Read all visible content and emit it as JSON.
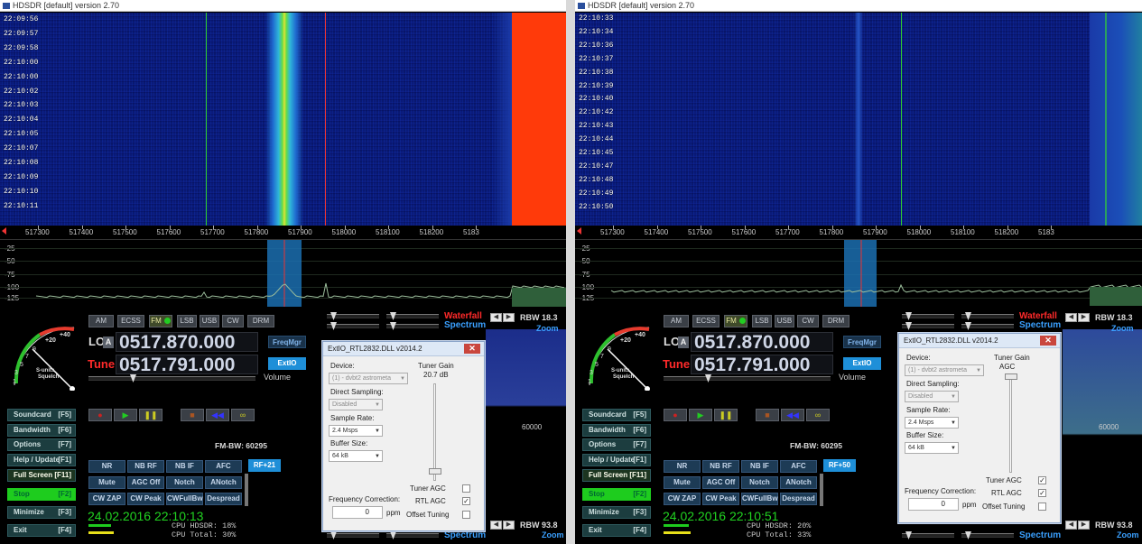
{
  "left": {
    "title": "HDSDR [default]  version 2.70",
    "timestamps": [
      "22:09:56",
      "22:09:57",
      "22:09:58",
      "22:10:00",
      "22:10:00",
      "22:10:02",
      "22:10:03",
      "22:10:04",
      "22:10:05",
      "22:10:07",
      "22:10:08",
      "22:10:09",
      "22:10:10",
      "22:10:11"
    ],
    "freq_ticks": [
      "517300",
      "517400",
      "517500",
      "517600",
      "517700",
      "517800",
      "517900",
      "518000",
      "518100",
      "518200",
      "5183"
    ],
    "db_labels": [
      "-25",
      "-50",
      "-75",
      "-100",
      "-125"
    ],
    "lo_label": "LO",
    "a_label": "A",
    "lo_value": "0517.870.000",
    "tune_label": "Tune",
    "tune_value": "0517.791.000",
    "fmbw": "FM-BW: 60295",
    "rf_button": "RF+21",
    "date": "24.02.2016 22:10:13",
    "cpu_hdsdr": "CPU HDSDR: 18%",
    "cpu_total": "CPU Total: 30%",
    "cpu_hdsdr_level": 0.18,
    "cpu_total_level": 0.3,
    "dialog": {
      "title": "ExtIO_RTL2832.DLL v2014.2",
      "device_label": "Device:",
      "device_value": "(1) - dvbt2 astrometa",
      "direct_label": "Direct Sampling:",
      "direct_value": "Disabled",
      "rate_label": "Sample Rate:",
      "rate_value": "2.4 Msps",
      "buffer_label": "Buffer Size:",
      "buffer_value": "64 kB",
      "gain_label": "Tuner Gain",
      "gain_value": "20.7 dB",
      "tuner_agc": "Tuner AGC",
      "rtl_agc": "RTL AGC",
      "offset": "Offset Tuning",
      "tuner_agc_checked": false,
      "rtl_agc_checked": true,
      "offset_checked": false,
      "fc_label": "Frequency Correction:",
      "fc_value": "0",
      "fc_unit": "ppm"
    },
    "spectrum_tick": "60000"
  },
  "right": {
    "title": "HDSDR [default]  version 2.70",
    "timestamps": [
      "22:10:33",
      "22:10:34",
      "22:10:36",
      "22:10:37",
      "22:10:38",
      "22:10:39",
      "22:10:40",
      "22:10:42",
      "22:10:43",
      "22:10:44",
      "22:10:45",
      "22:10:47",
      "22:10:48",
      "22:10:49",
      "22:10:50"
    ],
    "freq_ticks": [
      "517300",
      "517400",
      "517500",
      "517600",
      "517700",
      "517800",
      "517900",
      "518000",
      "518100",
      "518200",
      "5183"
    ],
    "db_labels": [
      "-25",
      "-50",
      "-75",
      "-100",
      "-125"
    ],
    "lo_label": "LO",
    "a_label": "A",
    "lo_value": "0517.870.000",
    "tune_label": "Tune",
    "tune_value": "0517.791.000",
    "fmbw": "FM-BW: 60295",
    "rf_button": "RF+50",
    "date": "24.02.2016 22:10:51",
    "cpu_hdsdr": "CPU HDSDR: 20%",
    "cpu_total": "CPU Total: 33%",
    "cpu_hdsdr_level": 0.2,
    "cpu_total_level": 0.33,
    "dialog": {
      "title": "ExtIO_RTL2832.DLL v2014.2",
      "device_label": "Device:",
      "device_value": "(1) - dvbt2 astrometa",
      "direct_label": "Direct Sampling:",
      "direct_value": "Disabled",
      "rate_label": "Sample Rate:",
      "rate_value": "2.4 Msps",
      "buffer_label": "Buffer Size:",
      "buffer_value": "64 kB",
      "gain_label": "Tuner Gain",
      "gain_value": "AGC",
      "tuner_agc": "Tuner AGC",
      "rtl_agc": "RTL AGC",
      "offset": "Offset Tuning",
      "tuner_agc_checked": true,
      "rtl_agc_checked": true,
      "offset_checked": false,
      "fc_label": "Frequency Correction:",
      "fc_value": "0",
      "fc_unit": "ppm"
    },
    "spectrum_tick": "60000"
  },
  "modes": [
    "AM",
    "ECSS",
    "FM",
    "LSB",
    "USB",
    "CW",
    "DRM"
  ],
  "active_mode": "FM",
  "freqmgr": "FreqMgr",
  "extio": "ExtIO",
  "volume": "Volume",
  "waterfall": "Waterfall",
  "spectrum": "Spectrum",
  "zoom": "Zoom",
  "rbw_top": "RBW 18.3",
  "rbw_bottom": "RBW 93.8",
  "smeter": {
    "plus20": "+20",
    "plus40": "+40",
    "s9": "9",
    "s7": "7",
    "s5": "5",
    "s3": "3",
    "s1": "1",
    "label1": "S-units",
    "label2": "Squelch"
  },
  "side_buttons": [
    {
      "label": "Soundcard",
      "key": "[F5]"
    },
    {
      "label": "Bandwidth",
      "key": "[F6]"
    },
    {
      "label": "Options",
      "key": "[F7]"
    },
    {
      "label": "Help / Update",
      "key": "[F1]"
    },
    {
      "label": "Full Screen",
      "key": "[F11]"
    },
    {
      "label": "Stop",
      "key": "[F2]"
    },
    {
      "label": "Minimize",
      "key": "[F3]"
    },
    {
      "label": "Exit",
      "key": "[F4]"
    }
  ],
  "dsp_buttons": [
    [
      "NR",
      "NB RF",
      "NB IF",
      "AFC"
    ],
    [
      "Mute",
      "AGC Off",
      "Notch",
      "ANotch"
    ],
    [
      "CW ZAP",
      "CW Peak",
      "CWFullBw",
      "Despread"
    ]
  ],
  "colors": {
    "accent": "#1e8fd8",
    "stop_green": "#1ecc1e",
    "red_label": "#ff2a2a",
    "waterfall_bg": "#0b2186"
  }
}
